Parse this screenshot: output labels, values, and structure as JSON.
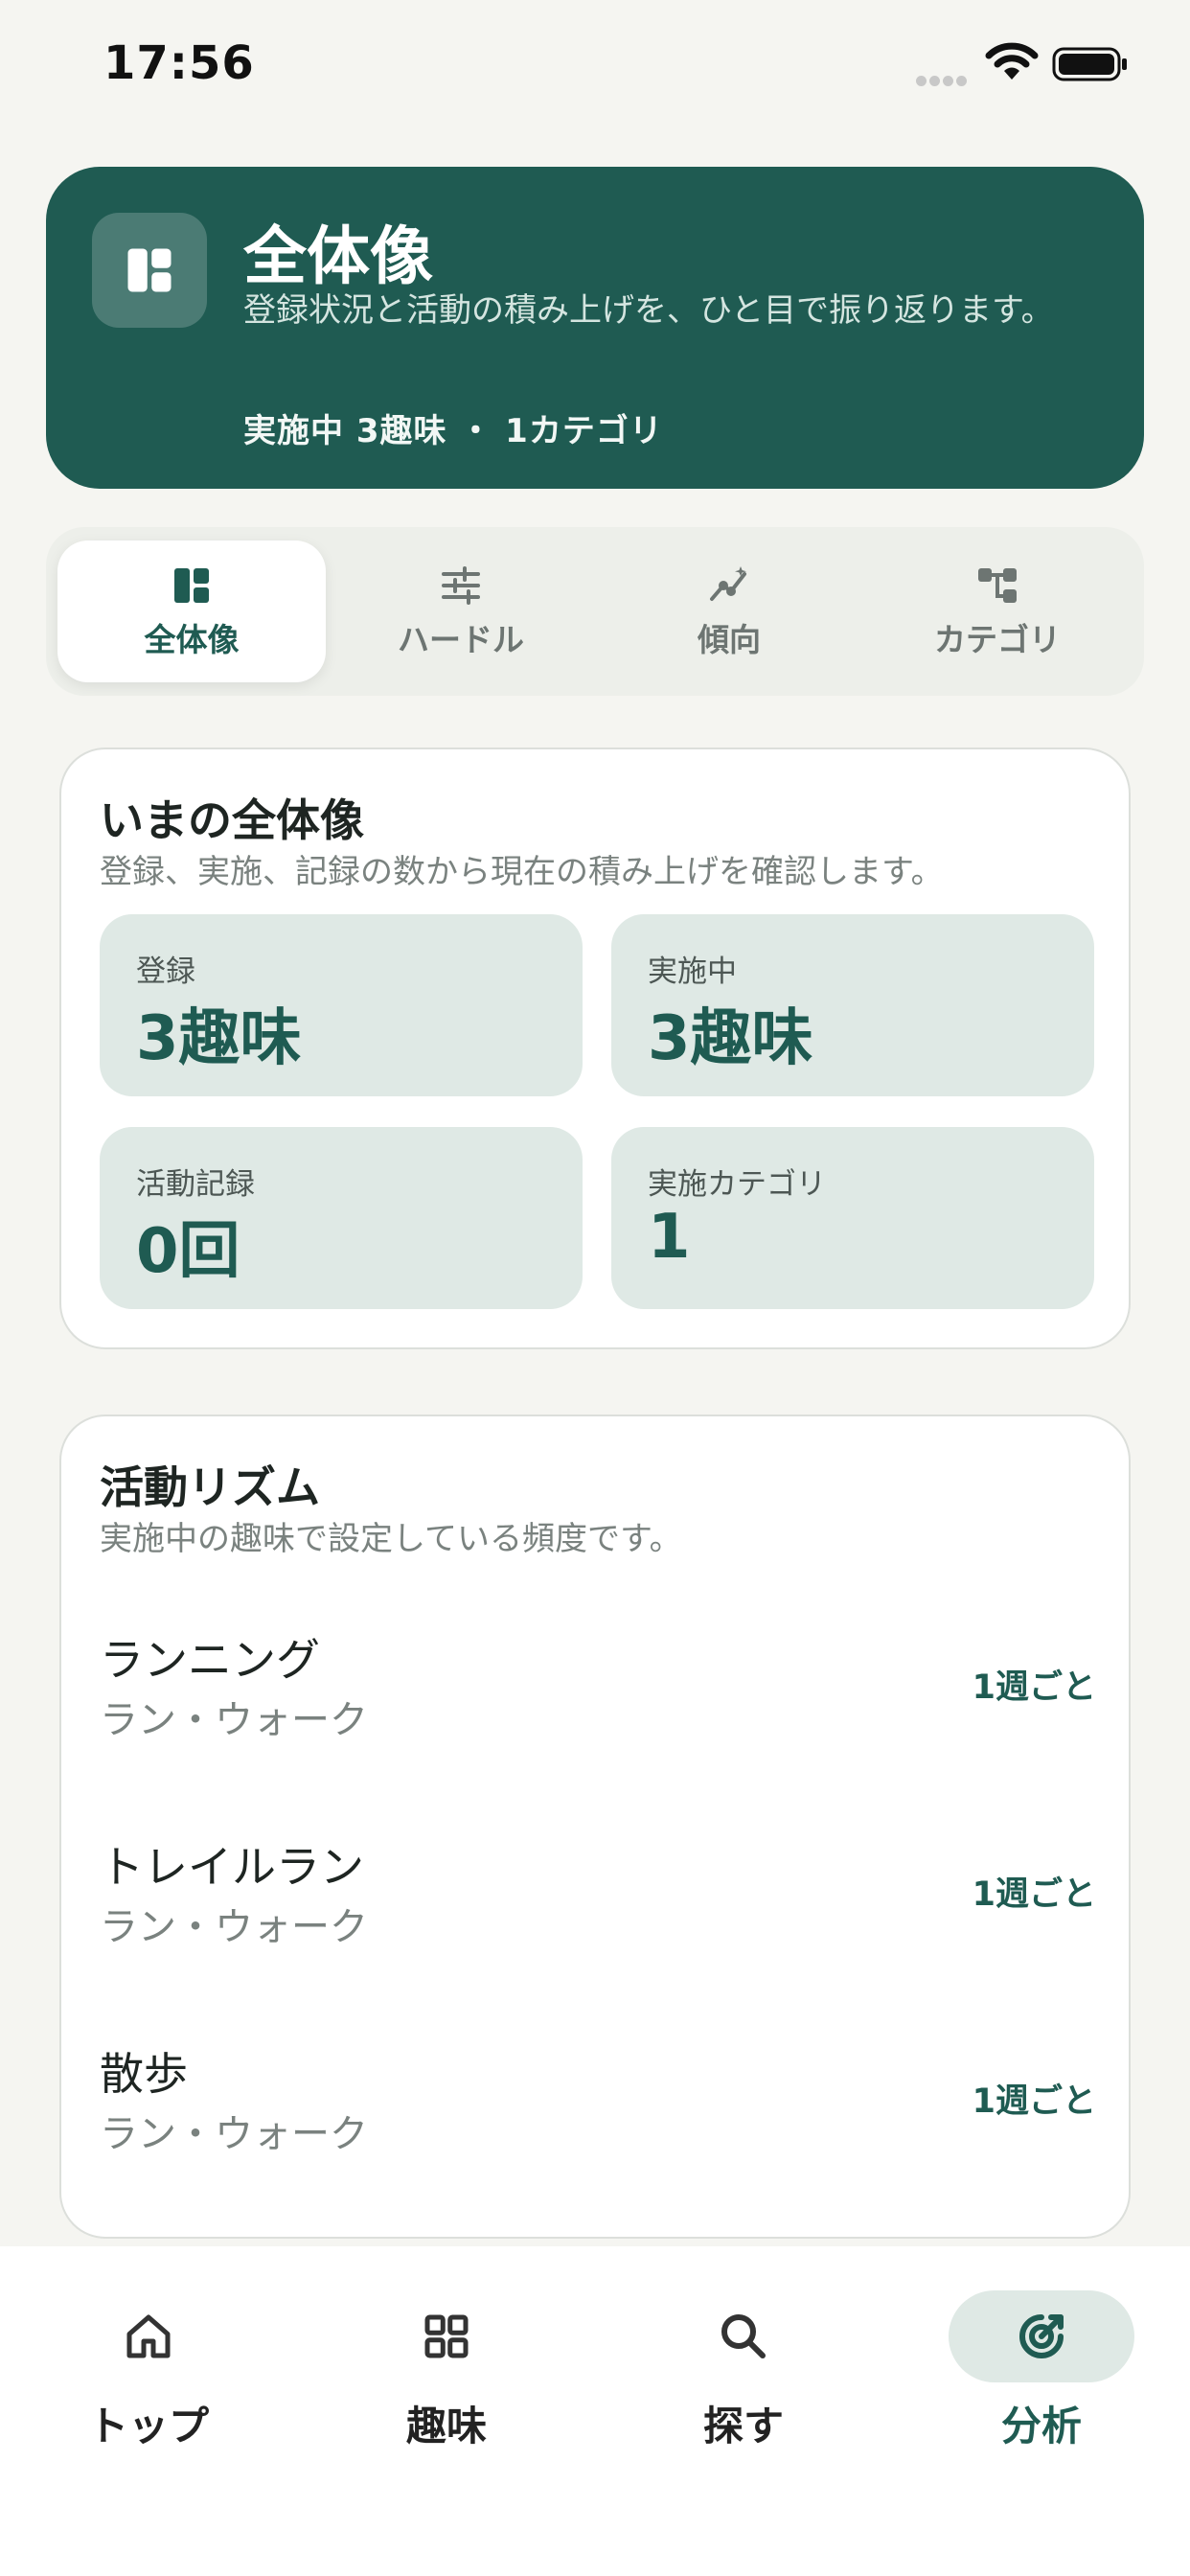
{
  "status_bar": {
    "time": "17:56"
  },
  "hero": {
    "title": "全体像",
    "description": "登録状況と活動の積み上げを、ひと目で振り返ります。",
    "stats": "実施中 3趣味 ・ 1カテゴリ",
    "icon": "dashboard-icon"
  },
  "segments": [
    {
      "label": "全体像",
      "icon": "dashboard-icon",
      "active": true
    },
    {
      "label": "ハードル",
      "icon": "sliders-icon",
      "active": false
    },
    {
      "label": "傾向",
      "icon": "trend-icon",
      "active": false
    },
    {
      "label": "カテゴリ",
      "icon": "category-tree-icon",
      "active": false
    }
  ],
  "overview": {
    "title": "いまの全体像",
    "subtitle": "登録、実施、記録の数から現在の積み上げを確認します。",
    "stats": [
      {
        "label": "登録",
        "value": "3趣味"
      },
      {
        "label": "実施中",
        "value": "3趣味"
      },
      {
        "label": "活動記録",
        "value": "0回"
      },
      {
        "label": "実施カテゴリ",
        "value": "1"
      }
    ]
  },
  "rhythm": {
    "title": "活動リズム",
    "subtitle": "実施中の趣味で設定している頻度です。",
    "items": [
      {
        "name": "ランニング",
        "category": "ラン・ウォーク",
        "frequency": "1週ごと"
      },
      {
        "name": "トレイルラン",
        "category": "ラン・ウォーク",
        "frequency": "1週ごと"
      },
      {
        "name": "散歩",
        "category": "ラン・ウォーク",
        "frequency": "1週ごと"
      }
    ]
  },
  "tabbar": [
    {
      "label": "トップ",
      "icon": "home-icon",
      "active": false
    },
    {
      "label": "趣味",
      "icon": "grid-icon",
      "active": false
    },
    {
      "label": "探す",
      "icon": "search-icon",
      "active": false
    },
    {
      "label": "分析",
      "icon": "analysis-target-icon",
      "active": true
    }
  ],
  "colors": {
    "accent": "#1f5b52",
    "accent_soft": "#dfe9e5",
    "background": "#f5f5f1"
  }
}
